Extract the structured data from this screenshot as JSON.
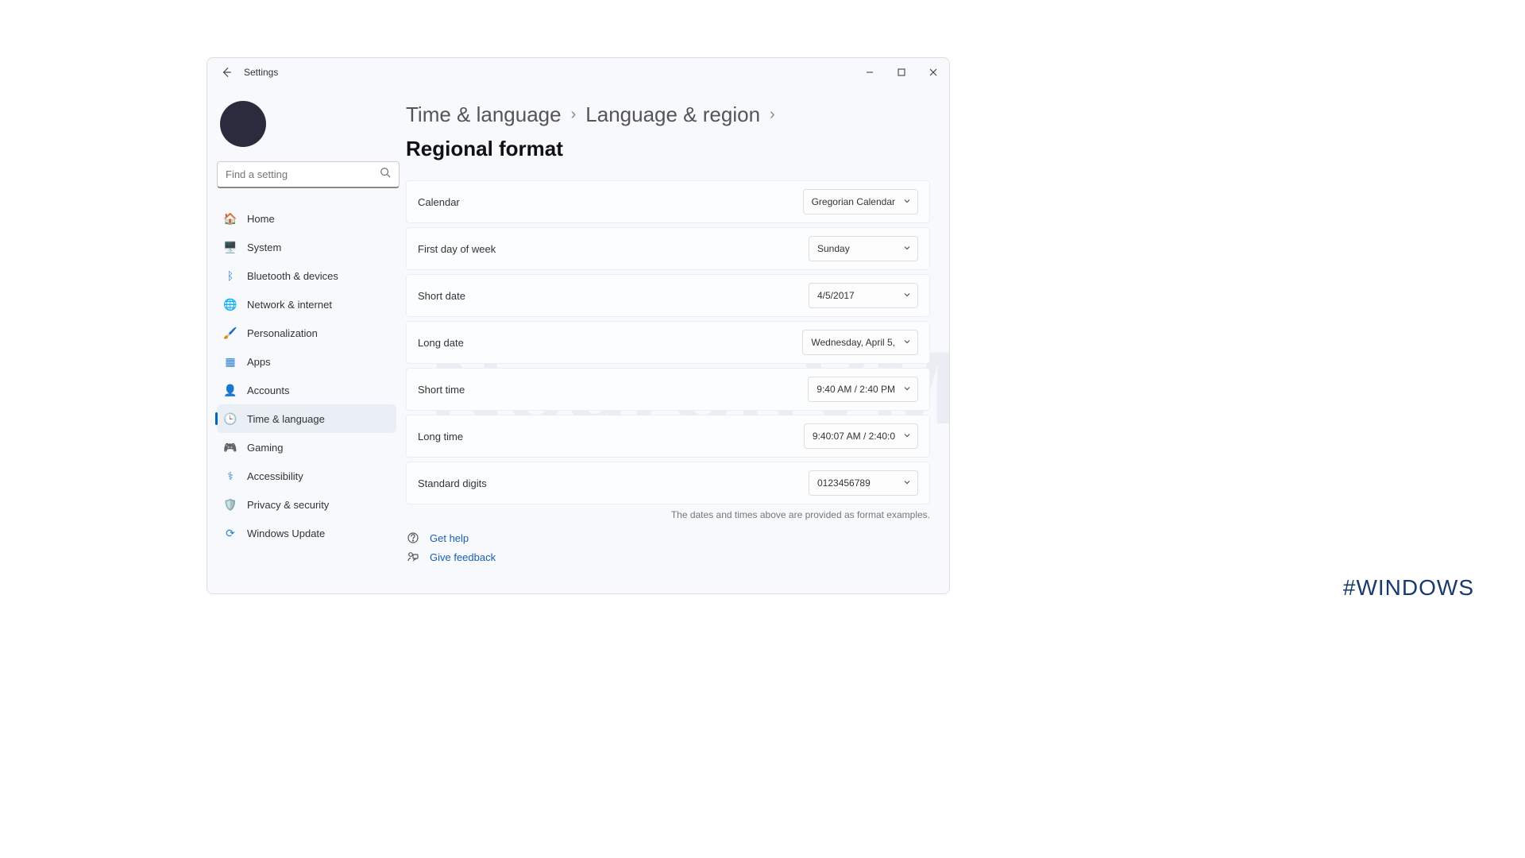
{
  "app_title": "Settings",
  "search": {
    "placeholder": "Find a setting"
  },
  "sidebar": {
    "items": [
      {
        "label": "Home",
        "icon": "🏠",
        "icon_color": "#e97435"
      },
      {
        "label": "System",
        "icon": "🖥️",
        "icon_color": "#2f7fd0"
      },
      {
        "label": "Bluetooth & devices",
        "icon": "ᛒ",
        "icon_color": "#2f7fd0"
      },
      {
        "label": "Network & internet",
        "icon": "🌐",
        "icon_color": "#2f7fd0"
      },
      {
        "label": "Personalization",
        "icon": "🖌️",
        "icon_color": "#a05a2c"
      },
      {
        "label": "Apps",
        "icon": "▦",
        "icon_color": "#2f7fd0"
      },
      {
        "label": "Accounts",
        "icon": "👤",
        "icon_color": "#1a9e6c"
      },
      {
        "label": "Time & language",
        "icon": "🕒",
        "icon_color": "#2f7fd0",
        "active": true
      },
      {
        "label": "Gaming",
        "icon": "🎮",
        "icon_color": "#888"
      },
      {
        "label": "Accessibility",
        "icon": "⚕",
        "icon_color": "#2f7fd0"
      },
      {
        "label": "Privacy & security",
        "icon": "🛡️",
        "icon_color": "#888"
      },
      {
        "label": "Windows Update",
        "icon": "⟳",
        "icon_color": "#2f7fd0"
      }
    ]
  },
  "breadcrumb": {
    "a": "Time & language",
    "b": "Language & region",
    "current": "Regional format"
  },
  "rows": [
    {
      "label": "Calendar",
      "value": "Gregorian Calendar"
    },
    {
      "label": "First day of week",
      "value": "Sunday"
    },
    {
      "label": "Short date",
      "value": "4/5/2017"
    },
    {
      "label": "Long date",
      "value": "Wednesday, April 5,"
    },
    {
      "label": "Short time",
      "value": "9:40 AM / 2:40 PM"
    },
    {
      "label": "Long time",
      "value": "9:40:07 AM / 2:40:0"
    },
    {
      "label": "Standard digits",
      "value": "0123456789"
    }
  ],
  "footnote": "The dates and times above are provided as format examples.",
  "help": {
    "get_help": "Get help",
    "feedback": "Give feedback"
  },
  "hashtag": "#WINDOWS",
  "watermark": "NeuronVM"
}
